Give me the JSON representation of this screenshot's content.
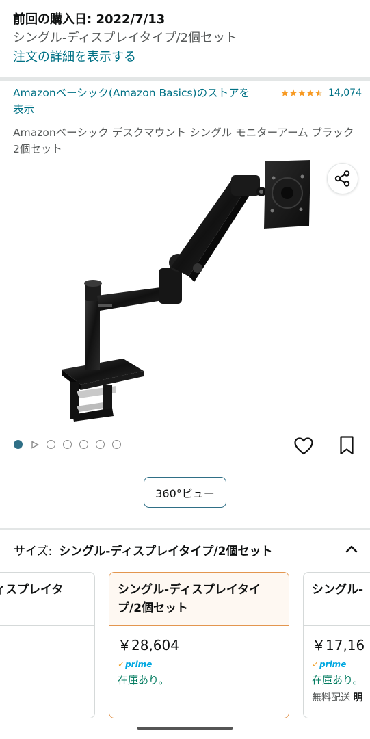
{
  "purchase": {
    "last_purchased": "前回の購入日: 2022/7/13",
    "variant": "シングル-ディスプレイタイプ/2個セット",
    "details_link": "注文の詳細を表示する"
  },
  "product": {
    "store_link": "Amazonベーシック(Amazon Basics)のストアを表示",
    "rating_value": 4.5,
    "rating_count": "14,074",
    "title": "Amazonベーシック デスクマウント シングル モニターアーム ブラック 2個セット"
  },
  "gallery": {
    "total_images": 7,
    "current_index": 1,
    "view360_label": "360°ビュー"
  },
  "size_selector": {
    "label": "サイズ:",
    "value": "シングル-ディスプレイタイプ/2個セット"
  },
  "options": [
    {
      "title": "ィスプレイタ",
      "price": "",
      "prime": "",
      "stock": "",
      "shipping": ""
    },
    {
      "title": "シングル-ディスプレイタイプ/2個セット",
      "price": "￥28,604",
      "prime": "prime",
      "stock": "在庫あり。",
      "shipping": ""
    },
    {
      "title": "シングル-",
      "price": "￥17,16",
      "prime": "prime",
      "stock": "在庫あり。",
      "shipping_prefix": "無料配送",
      "shipping_bold": "明"
    }
  ],
  "colors": {
    "link": "#007185",
    "star": "#f79a23",
    "stock": "#067d62",
    "selected_border": "#e3964f",
    "prime": "#00a8e1"
  }
}
